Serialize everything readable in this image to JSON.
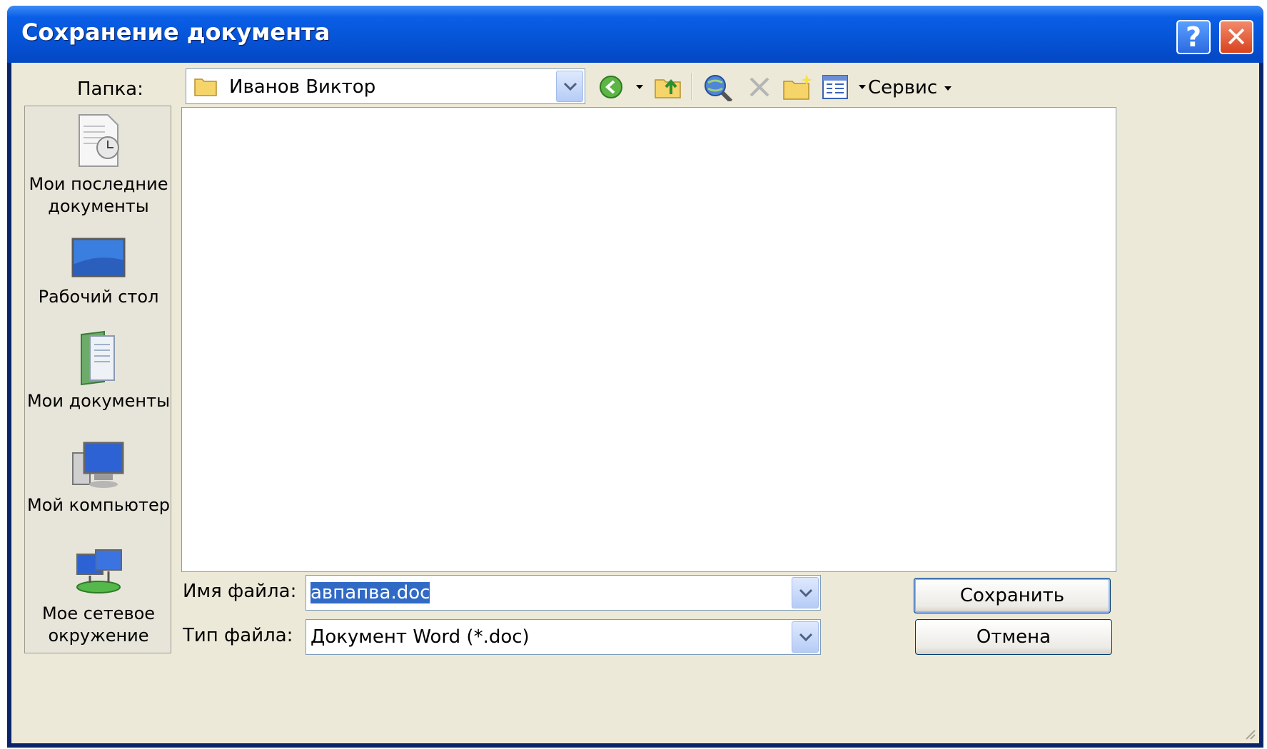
{
  "window": {
    "title": "Сохранение документа"
  },
  "header": {
    "folder_label": "Папка:",
    "folder_value": "Иванов Виктор",
    "service_label": "Сервис"
  },
  "places": [
    {
      "label": "Мои последние документы",
      "icon": "recent-documents-icon"
    },
    {
      "label": "Рабочий стол",
      "icon": "desktop-icon"
    },
    {
      "label": "Мои документы",
      "icon": "my-documents-icon"
    },
    {
      "label": "Мой компьютер",
      "icon": "my-computer-icon"
    },
    {
      "label": "Мое сетевое окружение",
      "icon": "network-places-icon"
    }
  ],
  "footer": {
    "filename_label": "Имя файла:",
    "filename_value": "авпапва.doc",
    "filetype_label": "Тип файла:",
    "filetype_value": "Документ Word (*.doc)",
    "save_label": "Сохранить",
    "cancel_label": "Отмена"
  },
  "colors": {
    "titlebar": "#0653d6",
    "dialog_bg": "#ece9d8",
    "selection": "#316ac5"
  }
}
